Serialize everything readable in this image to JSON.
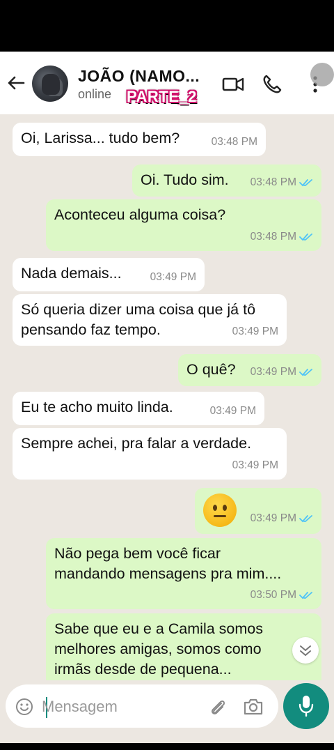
{
  "header": {
    "contact_name": "JOÃO (NAMO...",
    "status": "online",
    "overlay_label": "PARTE_2",
    "icons": [
      "back-arrow-icon",
      "video-call-icon",
      "voice-call-icon",
      "more-options-icon"
    ]
  },
  "messages": [
    {
      "dir": "in",
      "text": "Oi, Larissa... tudo bem?",
      "time": "03:48 PM"
    },
    {
      "dir": "out",
      "text": "Oi. Tudo sim.",
      "time": "03:48 PM",
      "read": true
    },
    {
      "dir": "out",
      "text": "Aconteceu alguma coisa?",
      "time": "03:48 PM",
      "read": true
    },
    {
      "dir": "in",
      "text": "Nada demais...",
      "time": "03:49 PM"
    },
    {
      "dir": "in",
      "text": "Só queria dizer uma coisa que já tô\npensando faz tempo.",
      "time": "03:49 PM"
    },
    {
      "dir": "out",
      "text": "O quê?",
      "time": "03:49 PM",
      "read": true
    },
    {
      "dir": "in",
      "text": "Eu te acho muito linda.",
      "time": "03:49 PM"
    },
    {
      "dir": "in",
      "text": "Sempre achei, pra falar a verdade.",
      "time": "03:49 PM"
    },
    {
      "dir": "out",
      "emoji": "neutral-face-emoji",
      "time": "03:49 PM",
      "read": true
    },
    {
      "dir": "out",
      "text": "Não pega bem você ficar\nmandando mensagens pra mim....",
      "time": "03:50 PM",
      "read": true
    },
    {
      "dir": "out",
      "text": "Sabe que eu e a Camila somos\nmelhores amigas, somos como\nirmãs desde de pequena..."
    }
  ],
  "composer": {
    "placeholder": "Mensagem",
    "icons": [
      "emoji-icon",
      "attach-icon",
      "camera-icon",
      "mic-icon"
    ]
  },
  "colors": {
    "accent": "#128c7e",
    "outgoing_bubble": "#dcf8c6",
    "incoming_bubble": "#ffffff",
    "chat_background": "#ece7e1",
    "read_ticks": "#4fc3f7"
  }
}
